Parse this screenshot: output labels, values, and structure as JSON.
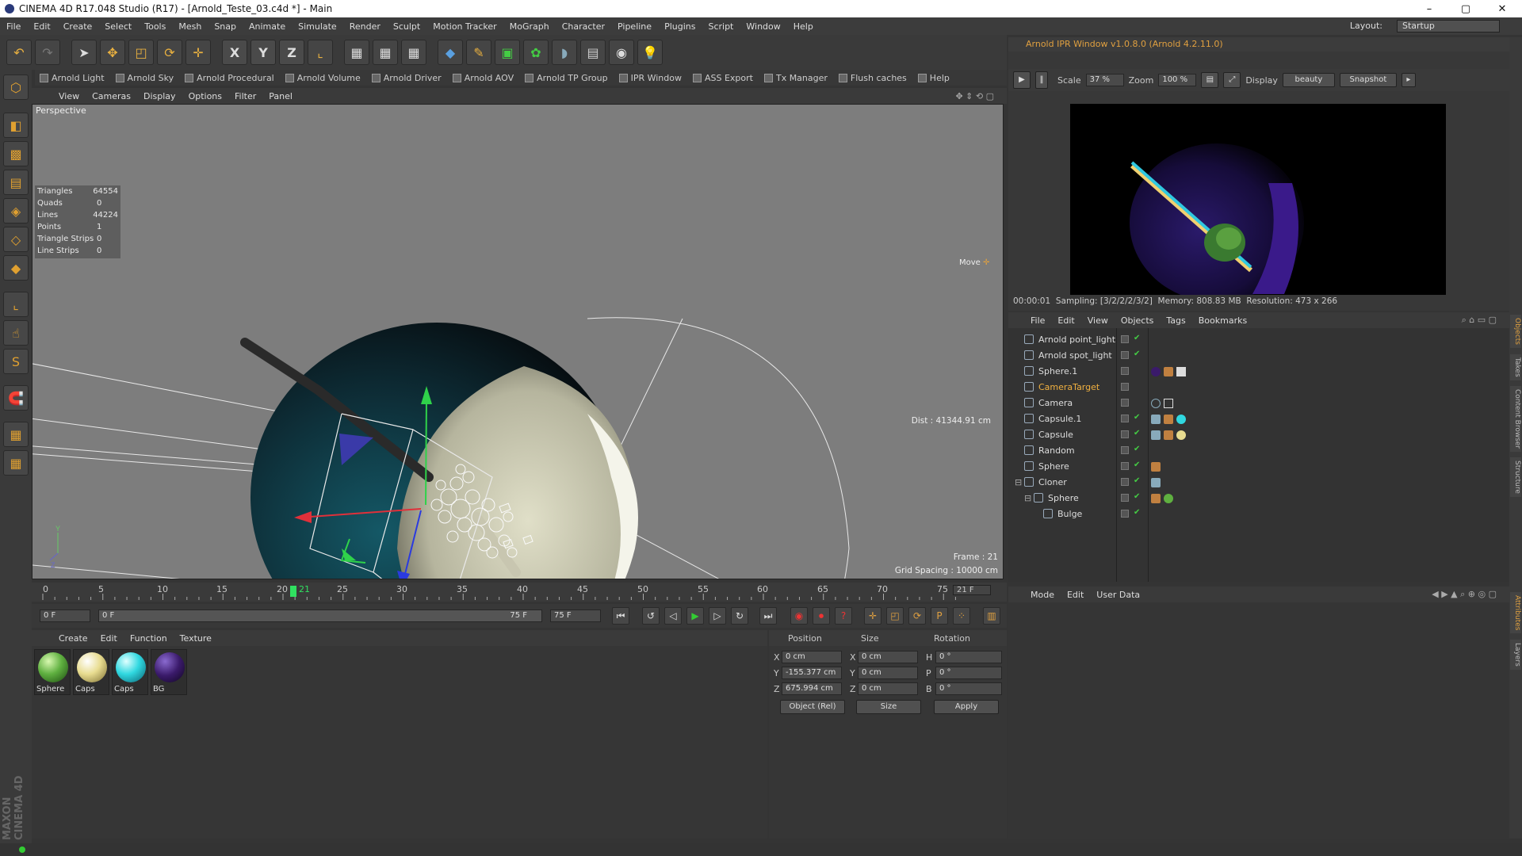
{
  "window": {
    "title": "CINEMA 4D R17.048 Studio (R17) - [Arnold_Teste_03.c4d *] - Main",
    "minimize": "–",
    "maximize": "▢",
    "close": "✕"
  },
  "menu": [
    "File",
    "Edit",
    "Create",
    "Select",
    "Tools",
    "Mesh",
    "Snap",
    "Animate",
    "Simulate",
    "Render",
    "Sculpt",
    "Motion Tracker",
    "MoGraph",
    "Character",
    "Pipeline",
    "Plugins",
    "Script",
    "Window",
    "Help"
  ],
  "layout": {
    "label": "Layout:",
    "value": "Startup"
  },
  "plugins": [
    "Arnold Light",
    "Arnold Sky",
    "Arnold Procedural",
    "Arnold Volume",
    "Arnold Driver",
    "Arnold AOV",
    "Arnold TP Group",
    "IPR Window",
    "ASS Export",
    "Tx Manager",
    "Flush caches",
    "Help"
  ],
  "viewport": {
    "menu": [
      "View",
      "Cameras",
      "Display",
      "Options",
      "Filter",
      "Panel"
    ],
    "name": "Perspective",
    "move_label": "Move",
    "dist": "Dist : 41344.91 cm",
    "frame": "Frame : 21",
    "grid": "Grid Spacing : 10000 cm",
    "stats": [
      {
        "k": "Triangles",
        "v": "64554"
      },
      {
        "k": "Quads",
        "v": "0"
      },
      {
        "k": "Lines",
        "v": "44224"
      },
      {
        "k": "Points",
        "v": "1"
      },
      {
        "k": "Triangle Strips",
        "v": "0"
      },
      {
        "k": "Line Strips",
        "v": "0"
      }
    ],
    "colors": {
      "bg": "#7d7d7d",
      "sphere_dark": "#0e1a22",
      "teal": "#0f4a57",
      "disk": "#c9c8b0"
    }
  },
  "timeline": {
    "ticks": [
      "0",
      "5",
      "10",
      "15",
      "20",
      "21",
      "25",
      "30",
      "35",
      "40",
      "45",
      "50",
      "55",
      "60",
      "65",
      "70",
      "75"
    ],
    "current": "21 F",
    "start": "0 F",
    "range_start": "0 F",
    "range_end": "75 F",
    "end": "75 F"
  },
  "materials": {
    "menu": [
      "Create",
      "Edit",
      "Function",
      "Texture"
    ],
    "items": [
      {
        "name": "Sphere",
        "color": "#5fb040"
      },
      {
        "name": "Caps",
        "color": "#e8dc90"
      },
      {
        "name": "Caps",
        "color": "#30d8e0"
      },
      {
        "name": "BG",
        "color": "#3a1a6a"
      }
    ]
  },
  "coords": {
    "headers": [
      "Position",
      "Size",
      "Rotation"
    ],
    "rows": [
      {
        "axis": "X",
        "pos": "0 cm",
        "saxis": "X",
        "size": "0 cm",
        "raxis": "H",
        "rot": "0 °"
      },
      {
        "axis": "Y",
        "pos": "-155.377 cm",
        "saxis": "Y",
        "size": "0 cm",
        "raxis": "P",
        "rot": "0 °"
      },
      {
        "axis": "Z",
        "pos": "675.994 cm",
        "saxis": "Z",
        "size": "0 cm",
        "raxis": "B",
        "rot": "0 °"
      }
    ],
    "mode": "Object (Rel)",
    "size_mode": "Size",
    "apply": "Apply"
  },
  "ipr": {
    "title": "Arnold IPR Window v1.0.8.0 (Arnold 4.2.11.0)",
    "scale_label": "Scale",
    "scale": "37 %",
    "zoom_label": "Zoom",
    "zoom": "100 %",
    "display_label": "Display",
    "display": "beauty",
    "snapshot": "Snapshot",
    "time": "00:00:01",
    "sampling": "Sampling: [3/2/2/2/3/2]",
    "memory": "Memory: 808.83 MB",
    "resolution": "Resolution: 473 x 266"
  },
  "objects": {
    "menu": [
      "File",
      "Edit",
      "View",
      "Objects",
      "Tags",
      "Bookmarks"
    ],
    "items": [
      {
        "name": "Arnold point_light",
        "indent": 0,
        "highlight": false
      },
      {
        "name": "Arnold spot_light",
        "indent": 0,
        "highlight": false
      },
      {
        "name": "Sphere.1",
        "indent": 0,
        "highlight": false
      },
      {
        "name": "CameraTarget",
        "indent": 0,
        "highlight": true
      },
      {
        "name": "Camera",
        "indent": 0,
        "highlight": false
      },
      {
        "name": "Capsule.1",
        "indent": 0,
        "highlight": false
      },
      {
        "name": "Capsule",
        "indent": 0,
        "highlight": false
      },
      {
        "name": "Random",
        "indent": 0,
        "highlight": false
      },
      {
        "name": "Sphere",
        "indent": 0,
        "highlight": false
      },
      {
        "name": "Cloner",
        "indent": 0,
        "highlight": false
      },
      {
        "name": "Sphere",
        "indent": 1,
        "highlight": false
      },
      {
        "name": "Bulge",
        "indent": 2,
        "highlight": false
      }
    ]
  },
  "attributes": {
    "menu": [
      "Mode",
      "Edit",
      "User Data"
    ]
  },
  "side_tabs": [
    "Objects",
    "Takes",
    "Content Browser",
    "Structure"
  ],
  "side_tabs2": [
    "Attributes",
    "Layers"
  ],
  "brand": "MAXON CINEMA 4D"
}
